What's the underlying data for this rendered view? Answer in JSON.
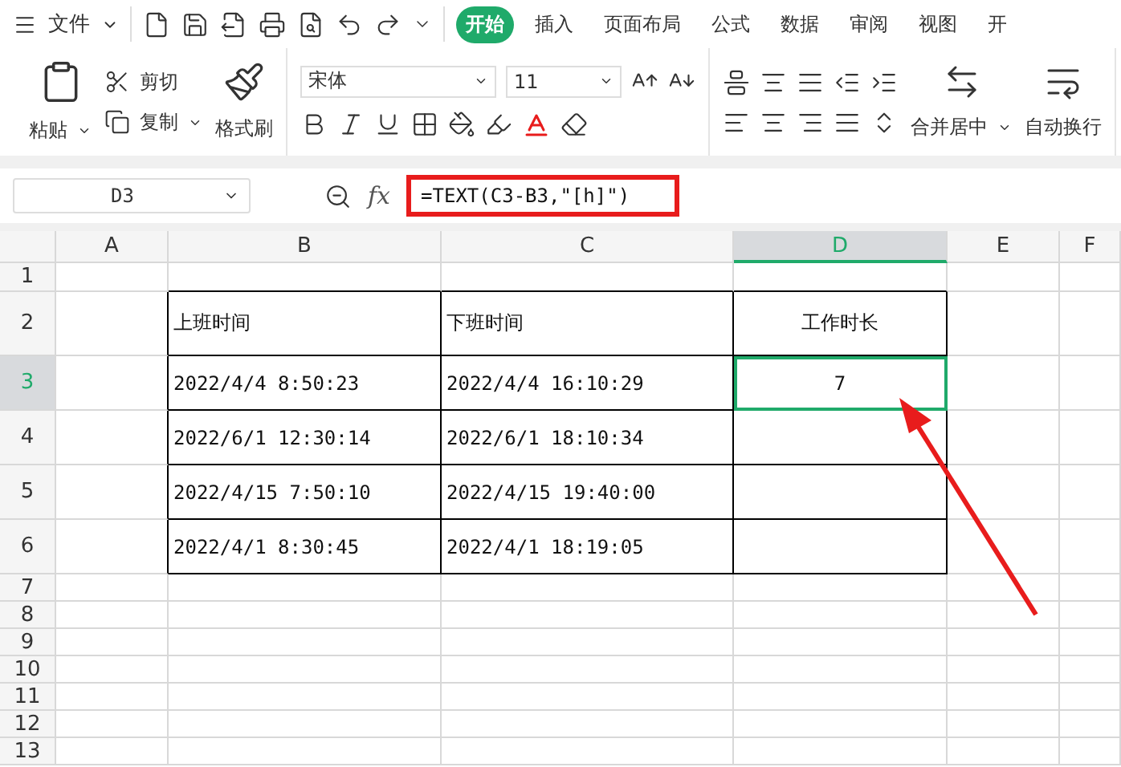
{
  "menu": {
    "file_label": "文件",
    "tabs": [
      {
        "label": "开始",
        "selected": true
      },
      {
        "label": "插入",
        "selected": false
      },
      {
        "label": "页面布局",
        "selected": false
      },
      {
        "label": "公式",
        "selected": false
      },
      {
        "label": "数据",
        "selected": false
      },
      {
        "label": "审阅",
        "selected": false
      },
      {
        "label": "视图",
        "selected": false
      },
      {
        "label": "开",
        "selected": false
      }
    ]
  },
  "ribbon": {
    "paste": "粘贴",
    "cut": "剪切",
    "copy": "复制",
    "format_painter": "格式刷",
    "font_name": "宋体",
    "font_size": "11",
    "merge": "合并居中",
    "wrap": "自动换行"
  },
  "formula_bar": {
    "name_box": "D3",
    "function_label": "fx",
    "formula": "=TEXT(C3-B3,\"[h]\")"
  },
  "sheet": {
    "columns": [
      {
        "label": "A",
        "selected": false
      },
      {
        "label": "B",
        "selected": false
      },
      {
        "label": "C",
        "selected": false
      },
      {
        "label": "D",
        "selected": true
      },
      {
        "label": "E",
        "selected": false
      },
      {
        "label": "F",
        "selected": false
      }
    ],
    "rows": [
      {
        "header": "1",
        "selected": false
      },
      {
        "header": "2",
        "selected": false,
        "column_b": "上班时间",
        "column_c": "下班时间",
        "column_d": "工作时长"
      },
      {
        "header": "3",
        "selected": true,
        "column_b": "2022/4/4 8:50:23",
        "column_c": "2022/4/4 16:10:29",
        "column_d": "7"
      },
      {
        "header": "4",
        "selected": false,
        "column_b": "2022/6/1 12:30:14",
        "column_c": "2022/6/1 18:10:34"
      },
      {
        "header": "5",
        "selected": false,
        "column_b": "2022/4/15 7:50:10",
        "column_c": "2022/4/15 19:40:00"
      },
      {
        "header": "6",
        "selected": false,
        "column_b": "2022/4/1 8:30:45",
        "column_c": "2022/4/1 18:19:05"
      },
      {
        "header": "7",
        "selected": false
      },
      {
        "header": "8",
        "selected": false
      },
      {
        "header": "9",
        "selected": false
      },
      {
        "header": "10",
        "selected": false
      },
      {
        "header": "11",
        "selected": false
      },
      {
        "header": "12",
        "selected": false
      },
      {
        "header": "13",
        "selected": false
      }
    ]
  }
}
